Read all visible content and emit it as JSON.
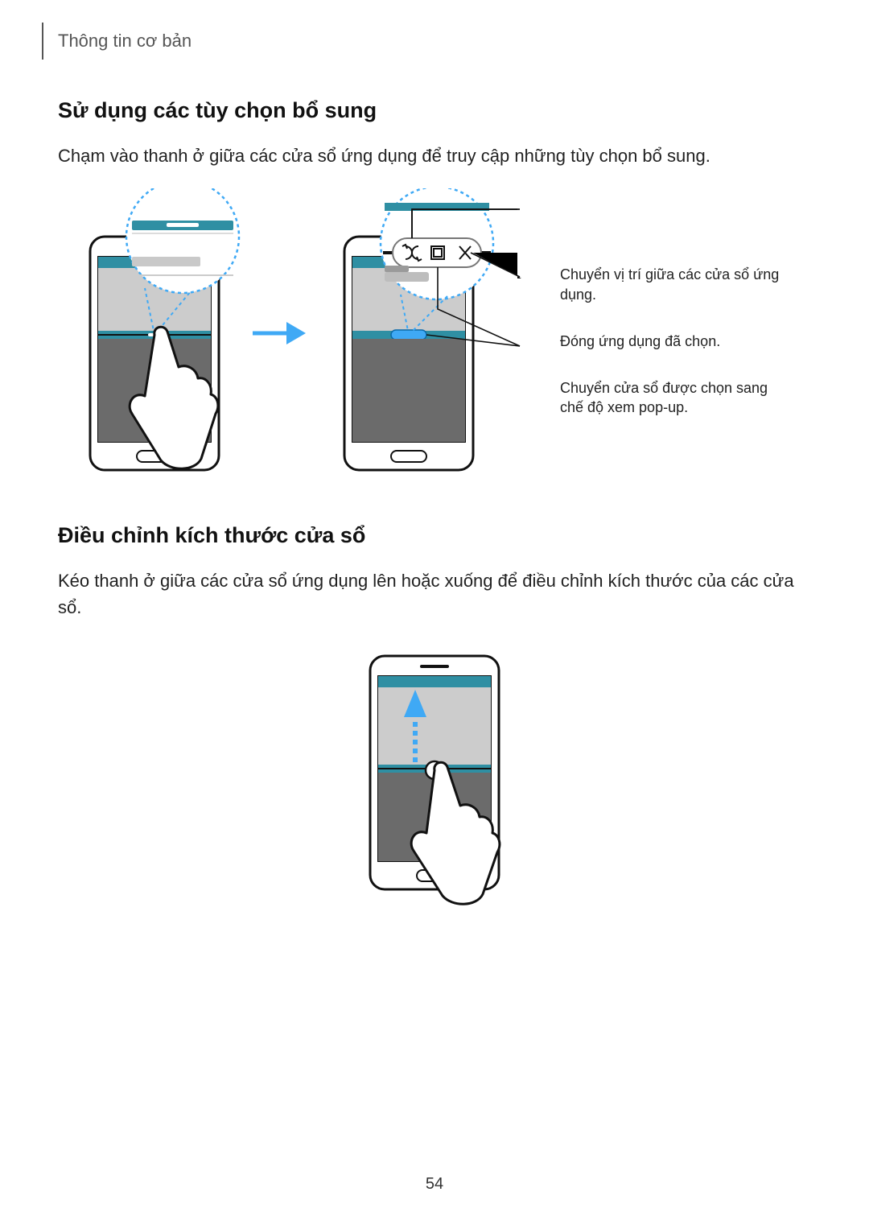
{
  "header": {
    "chapter": "Thông tin cơ bản"
  },
  "section1": {
    "heading": "Sử dụng các tùy chọn bổ sung",
    "body": "Chạm vào thanh ở giữa các cửa sổ ứng dụng để truy cập những tùy chọn bổ sung.",
    "callouts": {
      "swap": "Chuyển vị trí giữa các cửa sổ ứng dụng.",
      "close": "Đóng ứng dụng đã chọn.",
      "popup": "Chuyển cửa sổ được chọn sang chế độ xem pop-up."
    }
  },
  "section2": {
    "heading": "Điều chỉnh kích thước cửa sổ",
    "body": "Kéo thanh ở giữa các cửa sổ ứng dụng lên hoặc xuống để điều chỉnh kích thước của các cửa sổ."
  },
  "pageNumber": "54"
}
